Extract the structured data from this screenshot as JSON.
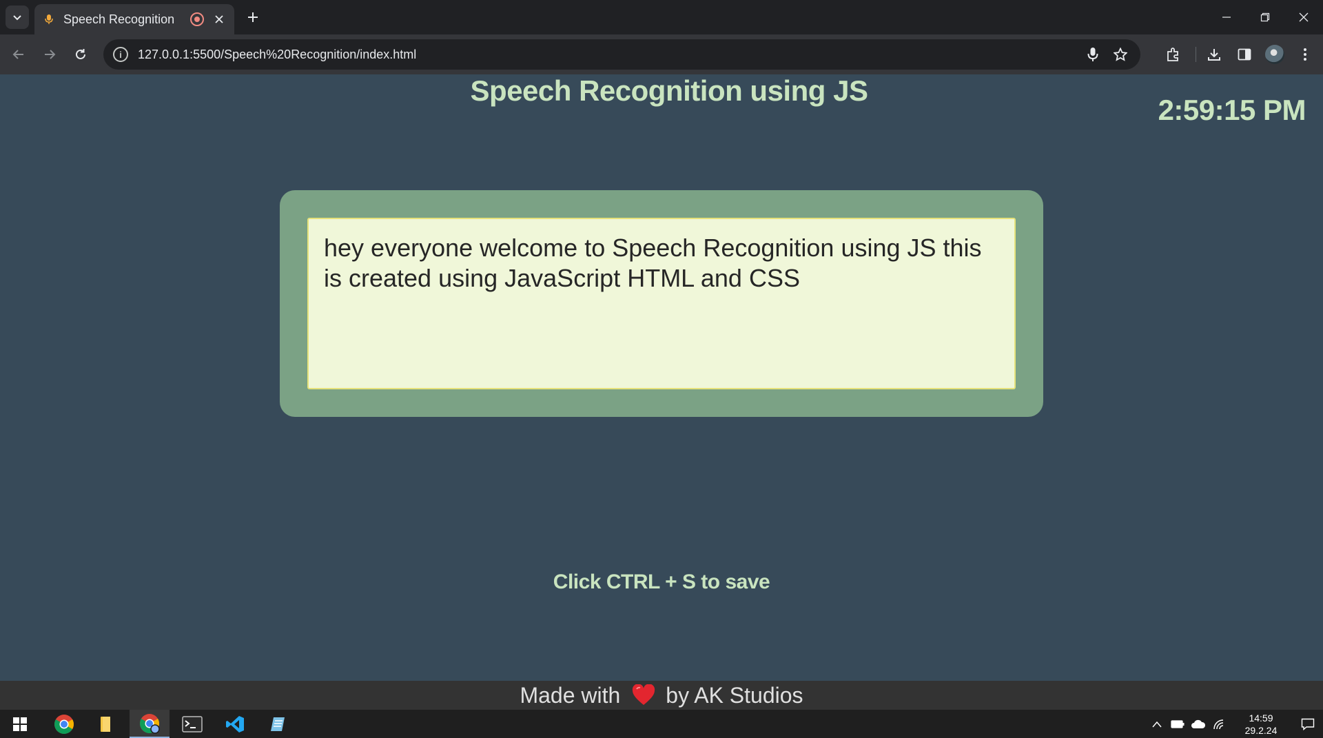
{
  "browser": {
    "tab": {
      "title": "Speech Recognition"
    },
    "url": "127.0.0.1:5500/Speech%20Recognition/index.html"
  },
  "page": {
    "title": "Speech Recognition using JS",
    "clock": "2:59:15 PM",
    "transcript": "hey everyone welcome to Speech Recognition using JS this is created using JavaScript HTML and CSS",
    "save_hint": "Click CTRL + S to save",
    "footer": {
      "prefix": "Made with",
      "suffix": "by AK Studios"
    },
    "colors": {
      "background": "#374a59",
      "accent_text": "#c9e4bf",
      "card": "#7ba285",
      "textarea": "#f0f7d9",
      "heart": "#e3262f"
    }
  },
  "taskbar": {
    "clock_time": "14:59",
    "clock_date": "29.2.24",
    "apps": [
      "start-icon",
      "chrome-icon",
      "file-explorer-icon",
      "chrome-profile-icon",
      "terminal-icon",
      "vscode-icon",
      "notepad-icon"
    ]
  }
}
